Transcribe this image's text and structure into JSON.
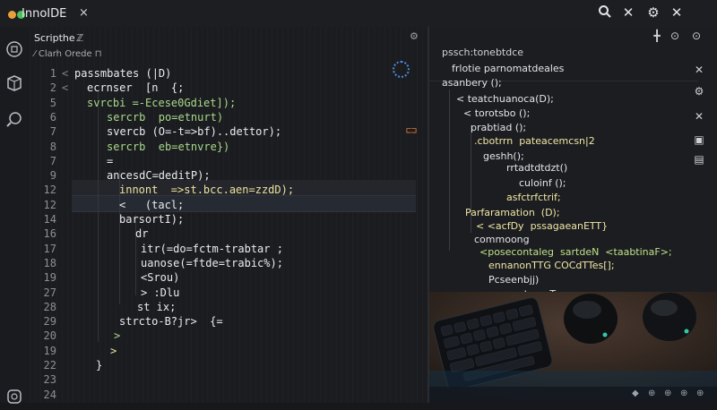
{
  "window": {
    "title": "InnoIDE",
    "close_glyph": "×",
    "icons": [
      "search-icon",
      "close-icon",
      "gear-icon",
      "close-icon"
    ]
  },
  "activity_bar": [
    "files-icon",
    "extensions-icon",
    "debug-icon",
    "account-icon"
  ],
  "editor": {
    "tab_label": "Scripthe",
    "tab_close": "ℤ",
    "breadcrumb": "⁄ Clarh Orede ⊓",
    "lines": [
      {
        "n": "1",
        "fold": "<",
        "text": "passmbates (|D)"
      },
      {
        "n": "2",
        "fold": "<",
        "text": "ecrnser  [n  {;"
      },
      {
        "n": "5",
        "fold": "",
        "text": "svrcbi =-Ecese0Gdiet]);"
      },
      {
        "n": "6",
        "fold": "",
        "text": "sercrb  po=etnurt)"
      },
      {
        "n": "7",
        "fold": "",
        "text": "svercb (O=-t=>bf)..dettor);"
      },
      {
        "n": "8",
        "fold": "",
        "text": "sercrb  eb=etnvre})"
      },
      {
        "n": "7",
        "fold": "",
        "text": "="
      },
      {
        "n": "9",
        "fold": "",
        "text": "ancesdC=deditP);"
      },
      {
        "n": "12",
        "fold": "",
        "text": "innont  =>st.bcc.aen=zzdD);"
      },
      {
        "n": "12",
        "fold": "",
        "text": "<   (tacl;"
      },
      {
        "n": "14",
        "fold": "",
        "text": "barsortI);"
      },
      {
        "n": "16",
        "fold": "",
        "text": "dr"
      },
      {
        "n": "17",
        "fold": "",
        "text": "itr(=do=fctm-trabtar ;"
      },
      {
        "n": "18",
        "fold": "",
        "text": "uanose(=ftde=trabic%);"
      },
      {
        "n": "19",
        "fold": "",
        "text": "<Srou)"
      },
      {
        "n": "27",
        "fold": "",
        "text": "> :Dlu"
      },
      {
        "n": "28",
        "fold": "",
        "text": "st ix;"
      },
      {
        "n": "29",
        "fold": "",
        "text": "strcto-B?jr>  {="
      },
      {
        "n": "20",
        "fold": "",
        "text": ">"
      },
      {
        "n": "19",
        "fold": "",
        "text": ">"
      },
      {
        "n": "22",
        "fold": "",
        "text": "}"
      },
      {
        "n": "23",
        "fold": "",
        "text": ""
      },
      {
        "n": "24",
        "fold": "",
        "text": ""
      }
    ],
    "orange_marker": "⊏⊐"
  },
  "right_panel": {
    "title": "pssch:tonebtdce",
    "header": "frlotie parnomatdeales",
    "lines": [
      "asanbery ();",
      "< teatchuanoca(D);",
      "< torotsbo ();",
      "prabtiad ();",
      ".cbotrrn  pateacemcsn|2",
      "geshh();",
      "rrtadtdtdzt()",
      "culoinf ();",
      "asfctrfctrif;",
      "Parfaramation  (D);",
      "< <acfDy  pssagaeanETT}",
      "commoong",
      "<posecontaleg  sartdeN  <taabtinaF>;",
      "ennanonTTG COCdTTes[];",
      "Pcseenbjj)",
      "peassentmanT"
    ],
    "right_icons": [
      "plus-icon",
      "refresh-icon",
      "more-icon",
      "close-icon",
      "gear-icon",
      "close-icon",
      "sidebar-icon",
      "panel-icon",
      "layout-icon"
    ]
  },
  "status_bar": {
    "right_glyphs": [
      "◆",
      "⊕",
      "⊕",
      "⊕",
      "⊕"
    ]
  },
  "colors": {
    "background": "#17181b",
    "editor_bg": "#1b1c1f",
    "active_line": "#262a33",
    "accent_blue": "#4a8de0",
    "string_green": "#a9d98c",
    "orange": "#e07a3a"
  }
}
